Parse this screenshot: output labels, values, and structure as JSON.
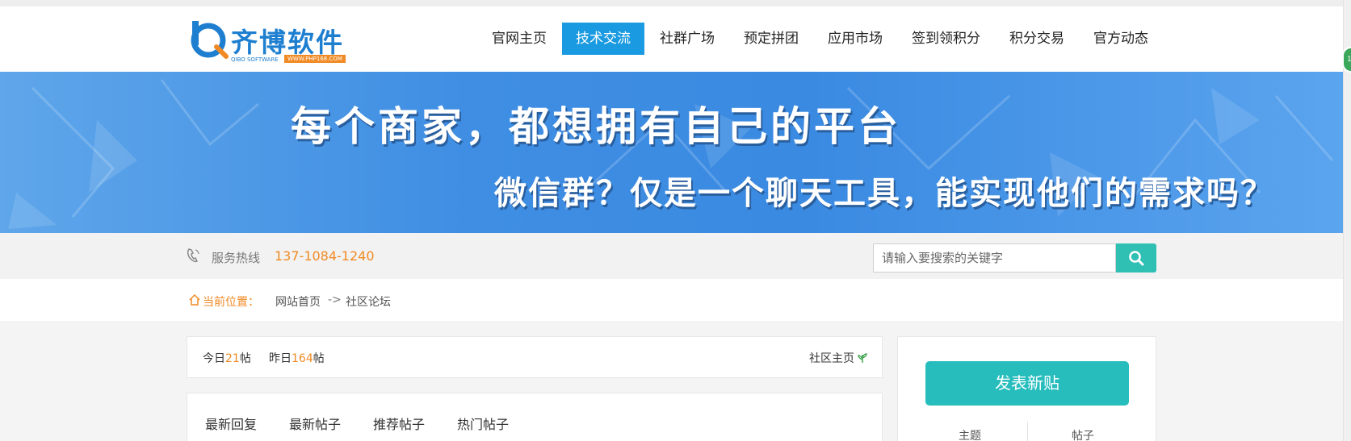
{
  "header": {
    "logo": {
      "title": "齐博软件",
      "subtitle": "QIBO SOFTWARE",
      "url": "WWW.PHP168.COM"
    },
    "nav": [
      {
        "label": "官网主页"
      },
      {
        "label": "技术交流",
        "active": true
      },
      {
        "label": "社群广场"
      },
      {
        "label": "预定拼团"
      },
      {
        "label": "应用市场"
      },
      {
        "label": "签到领积分"
      },
      {
        "label": "积分交易"
      },
      {
        "label": "官方动态"
      }
    ]
  },
  "banner": {
    "line1": "每个商家，都想拥有自己的平台",
    "line2": "微信群？仅是一个聊天工具，能实现他们的需求吗？"
  },
  "infobar": {
    "hotline_label": "服务热线",
    "hotline_number": "137-1084-1240",
    "search_placeholder": "请输入要搜索的关键字"
  },
  "breadcrumb": {
    "label": "当前位置：",
    "home": "网站首页",
    "separator": "->",
    "current": "社区论坛"
  },
  "stats": {
    "today_prefix": "今日",
    "today_count": "21",
    "today_suffix": "帖",
    "yesterday_prefix": "昨日",
    "yesterday_count": "164",
    "yesterday_suffix": "帖",
    "community_home": "社区主页"
  },
  "tabs": [
    {
      "label": "最新回复"
    },
    {
      "label": "最新帖子"
    },
    {
      "label": "推荐帖子"
    },
    {
      "label": "热门帖子"
    }
  ],
  "sidebar": {
    "post_button": "发表新贴",
    "columns": [
      "主题",
      "帖子"
    ]
  },
  "colors": {
    "nav_active": "#1a9ae0",
    "accent_orange": "#f08a24",
    "teal": "#27bdbd",
    "banner_blue": "#3f8ee3"
  }
}
